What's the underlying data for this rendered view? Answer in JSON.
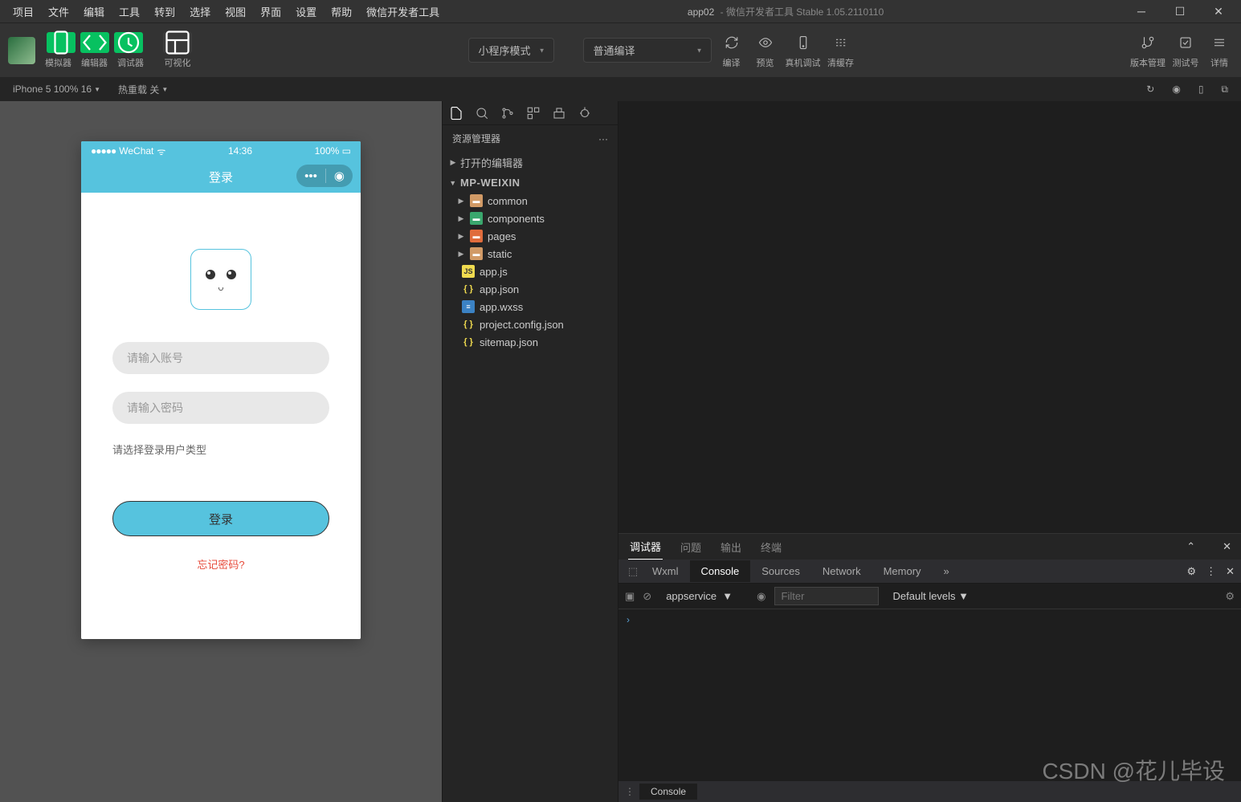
{
  "titlebar": {
    "menu": [
      "项目",
      "文件",
      "编辑",
      "工具",
      "转到",
      "选择",
      "视图",
      "界面",
      "设置",
      "帮助",
      "微信开发者工具"
    ],
    "project": "app02",
    "suffix": " - 微信开发者工具 Stable 1.05.2110110"
  },
  "toolbar": {
    "labels": {
      "simulator": "模拟器",
      "editor": "编辑器",
      "debugger": "调试器",
      "visualize": "可视化"
    },
    "mode_select": "小程序模式",
    "compile_select": "普通编译",
    "actions": {
      "compile": "编译",
      "preview": "预览",
      "realDebug": "真机调试",
      "clearCache": "清缓存"
    },
    "right": {
      "version": "版本管理",
      "testNum": "测试号",
      "details": "详情"
    }
  },
  "subbar": {
    "device": "iPhone 5 100% 16",
    "reload": "热重载 关"
  },
  "phone": {
    "status": {
      "carrier": "WeChat",
      "time": "14:36",
      "battery": "100%"
    },
    "nav_title": "登录",
    "placeholder_user": "请输入账号",
    "placeholder_pass": "请输入密码",
    "label_type": "请选择登录用户类型",
    "login_btn": "登录",
    "forgot": "忘记密码?"
  },
  "explorer": {
    "title": "资源管理器",
    "sections": {
      "openEditors": "打开的编辑器",
      "project": "MP-WEIXIN"
    },
    "folders": [
      "common",
      "components",
      "pages",
      "static"
    ],
    "files": [
      "app.js",
      "app.json",
      "app.wxss",
      "project.config.json",
      "sitemap.json"
    ]
  },
  "debugger": {
    "tabs1": [
      "调试器",
      "问题",
      "输出",
      "终端"
    ],
    "tabs2": [
      "Wxml",
      "Console",
      "Sources",
      "Network",
      "Memory"
    ],
    "context": "appservice",
    "filter_placeholder": "Filter",
    "levels": "Default levels",
    "bottom_tab": "Console"
  },
  "watermark": "CSDN @花儿毕设"
}
